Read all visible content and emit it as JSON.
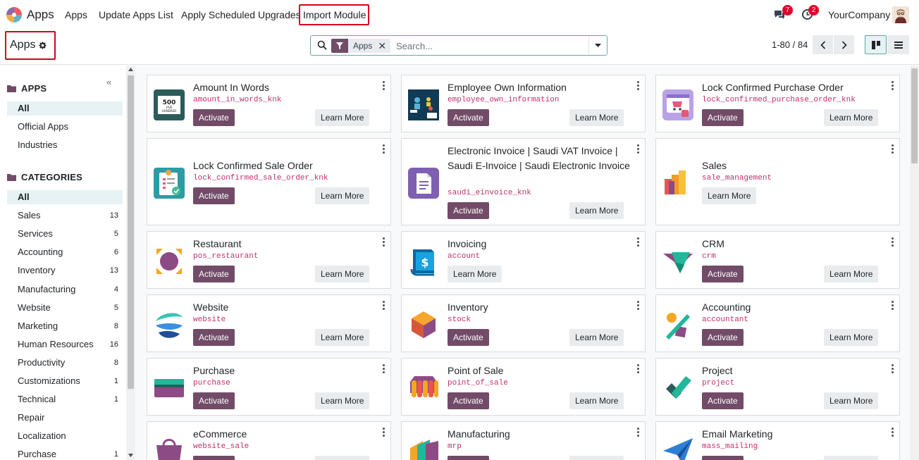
{
  "topbar": {
    "brand": "Apps",
    "menu": [
      "Apps",
      "Update Apps List",
      "Apply Scheduled Upgrades",
      "Import Module"
    ],
    "messages_count": "7",
    "activities_count": "2",
    "company": "YourCompany"
  },
  "control": {
    "breadcrumb": "Apps",
    "facet_label": "Apps",
    "search_placeholder": "Search...",
    "pager": "1-80 / 84"
  },
  "sidebar": {
    "apps_header": "APPS",
    "apps_items": [
      {
        "label": "All",
        "active": true
      },
      {
        "label": "Official Apps"
      },
      {
        "label": "Industries"
      }
    ],
    "categories_header": "CATEGORIES",
    "categories": [
      {
        "label": "All",
        "count": "",
        "active": true
      },
      {
        "label": "Sales",
        "count": "13"
      },
      {
        "label": "Services",
        "count": "5"
      },
      {
        "label": "Accounting",
        "count": "6"
      },
      {
        "label": "Inventory",
        "count": "13"
      },
      {
        "label": "Manufacturing",
        "count": "4"
      },
      {
        "label": "Website",
        "count": "5"
      },
      {
        "label": "Marketing",
        "count": "8"
      },
      {
        "label": "Human Resources",
        "count": "16"
      },
      {
        "label": "Productivity",
        "count": "8"
      },
      {
        "label": "Customizations",
        "count": "1"
      },
      {
        "label": "Technical",
        "count": "1"
      },
      {
        "label": "Repair",
        "count": ""
      },
      {
        "label": "Localization",
        "count": ""
      },
      {
        "label": "Purchase",
        "count": "1"
      }
    ]
  },
  "buttons": {
    "activate": "Activate",
    "learn_more": "Learn More"
  },
  "apps": [
    {
      "name": "Amount In Words",
      "tech": "amount_in_words_knk",
      "activate": true,
      "icon": "amount-words-icon"
    },
    {
      "name": "Employee Own Information",
      "tech": "employee_own_information",
      "activate": true,
      "icon": "employee-info-icon"
    },
    {
      "name": "Lock Confirmed Purchase Order",
      "tech": "lock_confirmed_purchase_order_knk",
      "activate": true,
      "icon": "lock-purchase-icon"
    },
    {
      "name": "Lock Confirmed Sale Order",
      "tech": "lock_confirmed_sale_order_knk",
      "activate": true,
      "icon": "lock-sale-icon"
    },
    {
      "name": "Electronic Invoice | Saudi VAT Invoice | Saudi E-Invoice | Saudi Electronic Invoice",
      "tech": "saudi_einvoice_knk",
      "activate": true,
      "icon": "einvoice-icon"
    },
    {
      "name": "Sales",
      "tech": "sale_management",
      "activate": false,
      "icon": "sales-icon"
    },
    {
      "name": "Restaurant",
      "tech": "pos_restaurant",
      "activate": true,
      "icon": "restaurant-icon"
    },
    {
      "name": "Invoicing",
      "tech": "account",
      "activate": false,
      "icon": "invoicing-icon"
    },
    {
      "name": "CRM",
      "tech": "crm",
      "activate": true,
      "icon": "crm-icon"
    },
    {
      "name": "Website",
      "tech": "website",
      "activate": true,
      "icon": "website-icon"
    },
    {
      "name": "Inventory",
      "tech": "stock",
      "activate": true,
      "icon": "inventory-icon"
    },
    {
      "name": "Accounting",
      "tech": "accountant",
      "activate": true,
      "icon": "accounting-icon"
    },
    {
      "name": "Purchase",
      "tech": "purchase",
      "activate": true,
      "icon": "purchase-icon"
    },
    {
      "name": "Point of Sale",
      "tech": "point_of_sale",
      "activate": true,
      "icon": "pos-icon"
    },
    {
      "name": "Project",
      "tech": "project",
      "activate": true,
      "icon": "project-icon"
    },
    {
      "name": "eCommerce",
      "tech": "website_sale",
      "activate": true,
      "icon": "ecommerce-icon"
    },
    {
      "name": "Manufacturing",
      "tech": "mrp",
      "activate": true,
      "icon": "manufacturing-icon"
    },
    {
      "name": "Email Marketing",
      "tech": "mass_mailing",
      "activate": true,
      "icon": "email-marketing-icon"
    }
  ]
}
